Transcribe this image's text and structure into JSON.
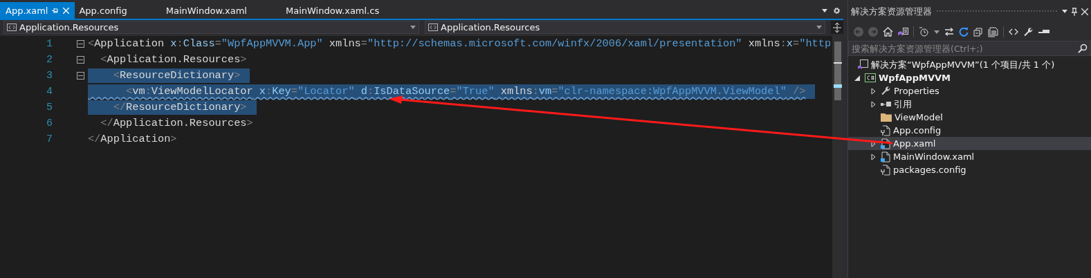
{
  "tabs": [
    {
      "label": "App.xaml",
      "selected": true
    },
    {
      "label": "App.config",
      "selected": false
    },
    {
      "label": "MainWindow.xaml",
      "selected": false
    },
    {
      "label": "MainWindow.xaml.cs",
      "selected": false
    }
  ],
  "nav_bar": {
    "left": "Application.Resources",
    "right": "Application.Resources"
  },
  "code_lines": [
    {
      "number": "1",
      "fold_button": true,
      "selected": false,
      "squiggle": false,
      "tokens": [
        {
          "kind": "punct",
          "text": "<"
        },
        {
          "kind": "element",
          "text": "Application"
        },
        {
          "kind": "attr",
          "text": " x"
        },
        {
          "kind": "punct",
          "text": ":"
        },
        {
          "kind": "attr",
          "text": "Class"
        },
        {
          "kind": "punct",
          "text": "="
        },
        {
          "kind": "value",
          "text": "\"WpfAppMVVM.App\""
        },
        {
          "kind": "element",
          "text": " xmlns"
        },
        {
          "kind": "punct",
          "text": "="
        },
        {
          "kind": "value",
          "text": "\"http://schemas.microsoft.com/winfx/2006/xaml/presentation\""
        },
        {
          "kind": "element",
          "text": " xmlns"
        },
        {
          "kind": "punct",
          "text": ":"
        },
        {
          "kind": "attr",
          "text": "x"
        },
        {
          "kind": "punct",
          "text": "="
        },
        {
          "kind": "value",
          "text": "\"http"
        }
      ]
    },
    {
      "number": "2",
      "fold_button": true,
      "selected": false,
      "squiggle": false,
      "tokens": [
        {
          "kind": "punct",
          "text": "  <"
        },
        {
          "kind": "element",
          "text": "Application.Resources"
        },
        {
          "kind": "punct",
          "text": ">"
        }
      ]
    },
    {
      "number": "3",
      "fold_button": true,
      "selected": true,
      "squiggle": false,
      "tokens": [
        {
          "kind": "punct",
          "text": "    <"
        },
        {
          "kind": "element",
          "text": "ResourceDictionary"
        },
        {
          "kind": "punct",
          "text": ">"
        }
      ]
    },
    {
      "number": "4",
      "fold_button": false,
      "selected": true,
      "squiggle": true,
      "tokens": [
        {
          "kind": "punct",
          "text": "      <"
        },
        {
          "kind": "element",
          "text": "vm"
        },
        {
          "kind": "punct",
          "text": ":"
        },
        {
          "kind": "element",
          "text": "ViewModelLocator"
        },
        {
          "kind": "attr",
          "text": " x"
        },
        {
          "kind": "punct",
          "text": ":"
        },
        {
          "kind": "attr",
          "text": "Key"
        },
        {
          "kind": "punct",
          "text": "="
        },
        {
          "kind": "value",
          "text": "\"Locator\""
        },
        {
          "kind": "attr",
          "text": " d"
        },
        {
          "kind": "punct",
          "text": ":"
        },
        {
          "kind": "attr",
          "text": "IsDataSource"
        },
        {
          "kind": "punct",
          "text": "="
        },
        {
          "kind": "value",
          "text": "\"True\""
        },
        {
          "kind": "element",
          "text": " xmlns"
        },
        {
          "kind": "punct",
          "text": ":"
        },
        {
          "kind": "attr",
          "text": "vm"
        },
        {
          "kind": "punct",
          "text": "="
        },
        {
          "kind": "value",
          "text": "\"clr-namespace:WpfAppMVVM.ViewModel\""
        },
        {
          "kind": "punct",
          "text": " />"
        }
      ]
    },
    {
      "number": "5",
      "fold_button": false,
      "selected": true,
      "squiggle": false,
      "tokens": [
        {
          "kind": "punct",
          "text": "    </"
        },
        {
          "kind": "element",
          "text": "ResourceDictionary"
        },
        {
          "kind": "punct",
          "text": ">"
        }
      ]
    },
    {
      "number": "6",
      "fold_button": false,
      "selected": false,
      "squiggle": false,
      "tokens": [
        {
          "kind": "punct",
          "text": "  </"
        },
        {
          "kind": "element",
          "text": "Application.Resources"
        },
        {
          "kind": "punct",
          "text": ">"
        }
      ]
    },
    {
      "number": "7",
      "fold_button": false,
      "selected": false,
      "squiggle": false,
      "tokens": [
        {
          "kind": "punct",
          "text": "</"
        },
        {
          "kind": "element",
          "text": "Application"
        },
        {
          "kind": "punct",
          "text": ">"
        }
      ]
    }
  ],
  "solution_explorer": {
    "title": "解决方案资源管理器",
    "search": {
      "placeholder": "搜索解决方案资源管理器(Ctrl+;)"
    },
    "solution": {
      "label": "解决方案“WpfAppMVVM”(1 个项目/共 1 个)"
    },
    "tree": [
      {
        "label": "WpfAppMVVM",
        "kind": "project",
        "expanded": true,
        "selected": false,
        "children": [
          {
            "label": "Properties",
            "kind": "wrench",
            "expanded": false,
            "selected": false
          },
          {
            "label": "引用",
            "kind": "references",
            "expanded": false,
            "selected": false
          },
          {
            "label": "ViewModel",
            "kind": "folder",
            "selected": false
          },
          {
            "label": "App.config",
            "kind": "config",
            "selected": false
          },
          {
            "label": "App.xaml",
            "kind": "xaml",
            "expanded": false,
            "selected": true
          },
          {
            "label": "MainWindow.xaml",
            "kind": "xaml",
            "expanded": false,
            "selected": false
          },
          {
            "label": "packages.config",
            "kind": "config",
            "selected": false
          }
        ]
      }
    ]
  }
}
